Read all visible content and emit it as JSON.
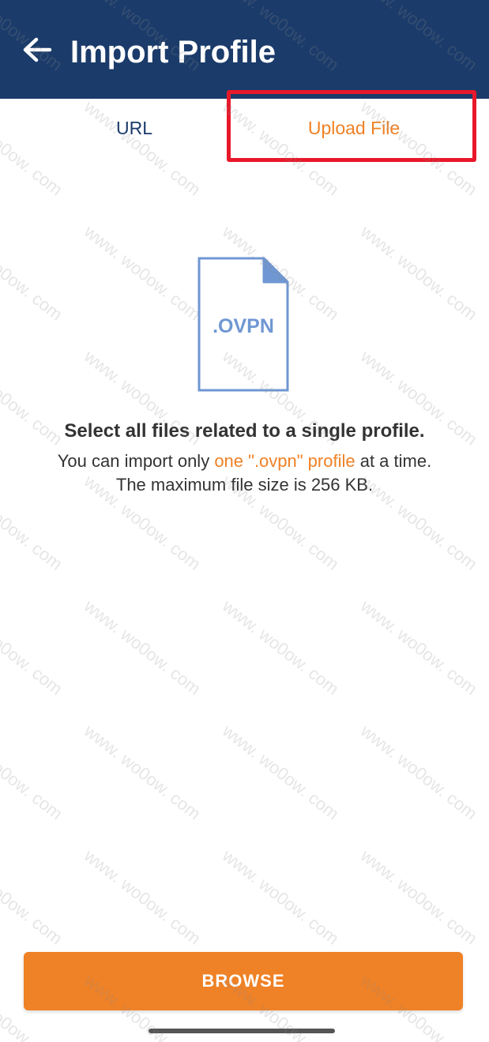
{
  "app_bar": {
    "title": "Import Profile",
    "back_icon": "arrow-left-icon",
    "background": "#1b3b6a"
  },
  "tabs": [
    {
      "label": "URL",
      "active": false
    },
    {
      "label": "Upload File",
      "active": true
    }
  ],
  "illustration": {
    "icon": "ovpn-file-icon",
    "label": ".OVPN",
    "color": "#6f97d3"
  },
  "content": {
    "headline": "Select all files related to a single profile.",
    "line1_before": "You can import only ",
    "line1_accent": "one \".ovpn\" profile",
    "line1_after": " at a time.",
    "line2": "The maximum file size is 256 KB."
  },
  "browse_button": {
    "label": "BROWSE"
  },
  "watermark": {
    "text": "www. wo0ow. com"
  },
  "colors": {
    "accent": "#ef8126",
    "primary": "#1b3b6a",
    "highlight": "#e8182a"
  }
}
